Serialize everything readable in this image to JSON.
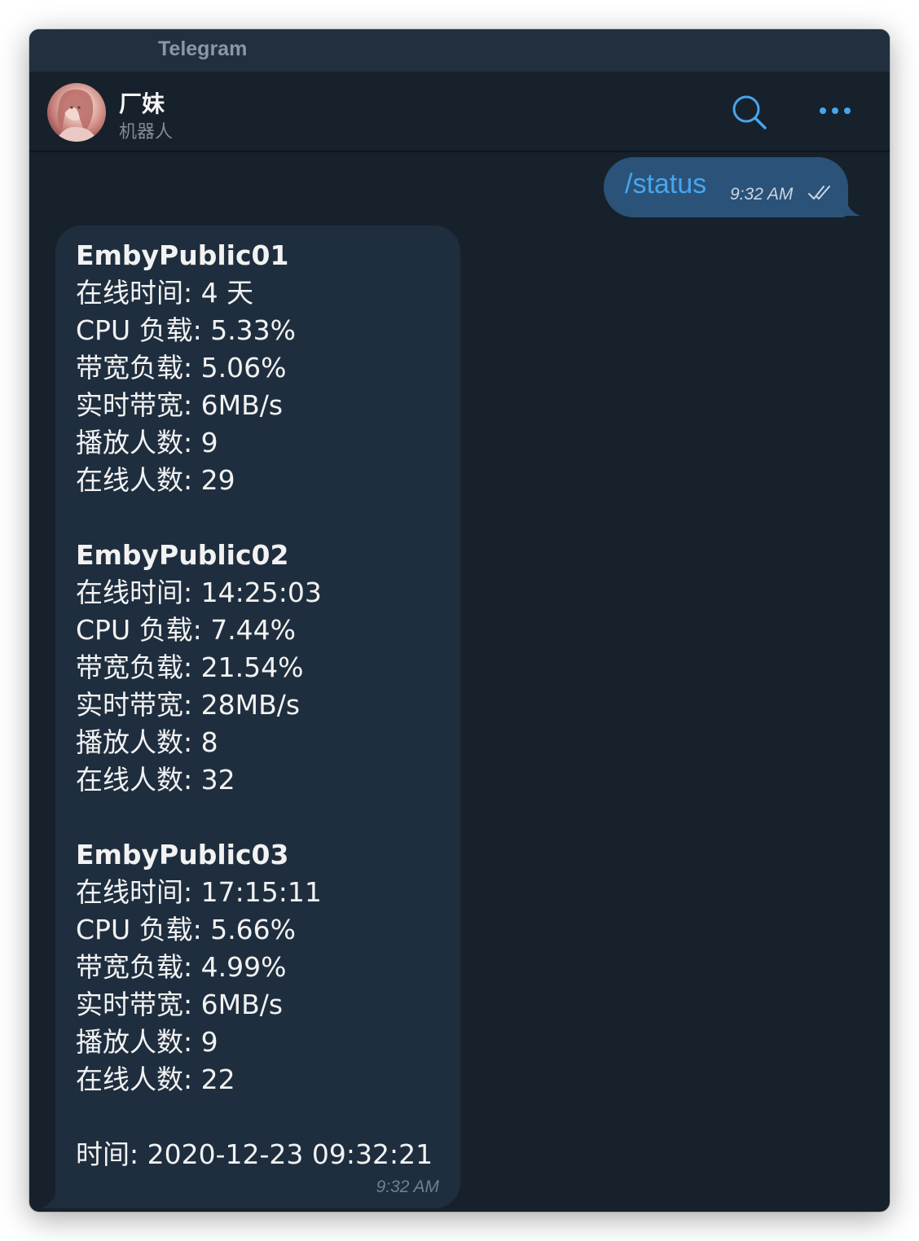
{
  "titlebar": {
    "app_title": "Telegram"
  },
  "chat_header": {
    "name": "厂妹",
    "status": "机器人"
  },
  "colors": {
    "window_bg": "#17212b",
    "titlebar_bg": "#212f3f",
    "accent": "#45a6ef",
    "outgoing_bubble": "#2b5278",
    "incoming_bubble": "#1f2e3e"
  },
  "icons": {
    "search": "search-icon",
    "more": "more-dots-icon",
    "read_receipt": "double-check-icon"
  },
  "messages": {
    "outgoing": {
      "text": "/status",
      "time": "9:32 AM"
    },
    "incoming": {
      "servers": [
        {
          "name": "EmbyPublic01",
          "uptime": "在线时间: 4 天",
          "cpu": "CPU 负载: 5.33%",
          "bandwidth_load": "带宽负载: 5.06%",
          "realtime_bandwidth": "实时带宽: 6MB/s",
          "playing": "播放人数: 9",
          "online": "在线人数: 29"
        },
        {
          "name": "EmbyPublic02",
          "uptime": "在线时间: 14:25:03",
          "cpu": "CPU 负载: 7.44%",
          "bandwidth_load": "带宽负载: 21.54%",
          "realtime_bandwidth": "实时带宽: 28MB/s",
          "playing": "播放人数: 8",
          "online": "在线人数: 32"
        },
        {
          "name": "EmbyPublic03",
          "uptime": "在线时间: 17:15:11",
          "cpu": "CPU 负载: 5.66%",
          "bandwidth_load": "带宽负载: 4.99%",
          "realtime_bandwidth": "实时带宽: 6MB/s",
          "playing": "播放人数: 9",
          "online": "在线人数: 22"
        }
      ],
      "footer": "时间: 2020-12-23 09:32:21",
      "time": "9:32 AM"
    }
  }
}
